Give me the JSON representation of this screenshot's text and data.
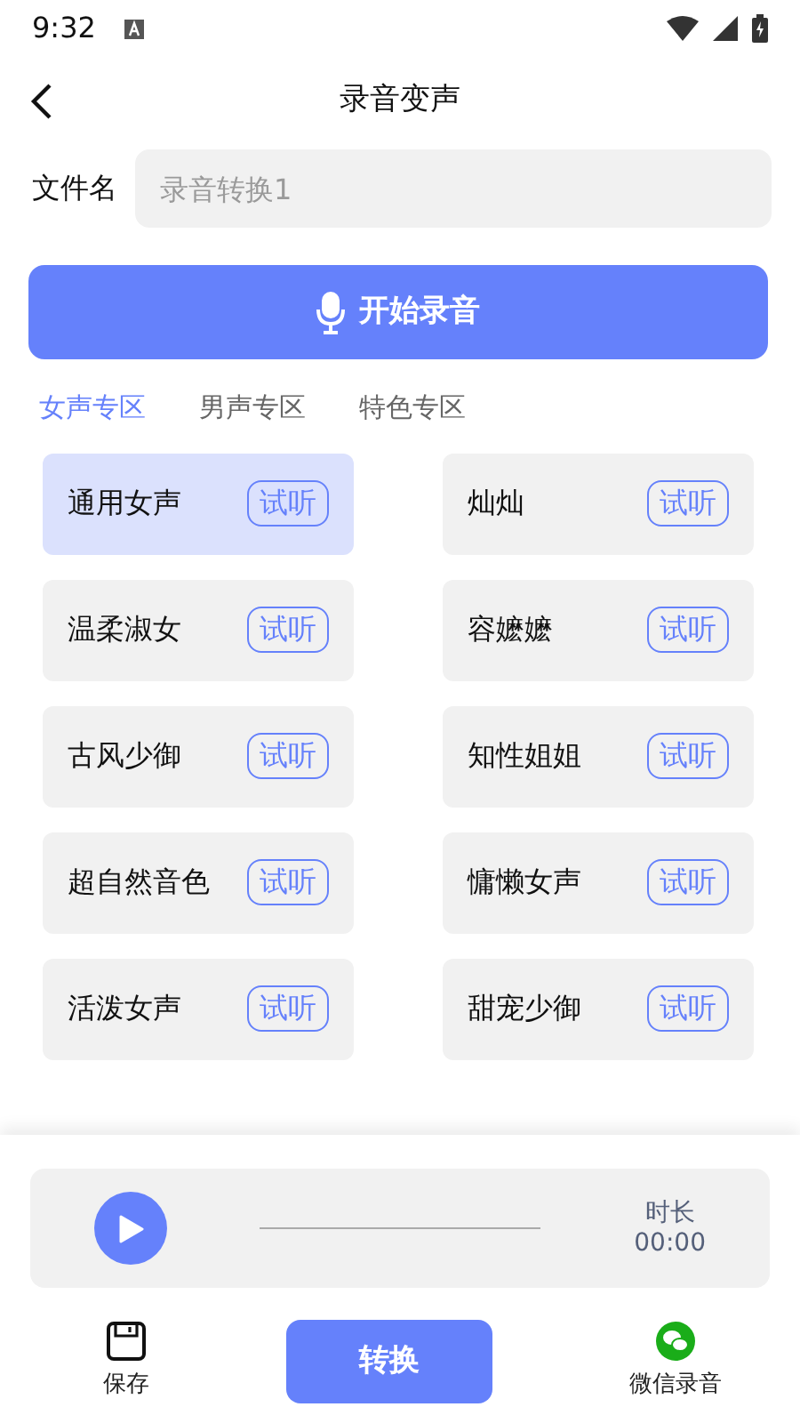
{
  "status_bar": {
    "time": "9:32"
  },
  "header": {
    "title": "录音变声"
  },
  "file_name": {
    "label": "文件名",
    "placeholder": "录音转换1"
  },
  "record_button": {
    "label": "开始录音"
  },
  "tabs": [
    {
      "label": "女声专区",
      "selected": true
    },
    {
      "label": "男声专区",
      "selected": false
    },
    {
      "label": "特色专区",
      "selected": false
    }
  ],
  "voices": [
    {
      "name": "通用女声",
      "action": "试听",
      "selected": true
    },
    {
      "name": "灿灿",
      "action": "试听",
      "selected": false
    },
    {
      "name": "温柔淑女",
      "action": "试听",
      "selected": false
    },
    {
      "name": "容嬷嬷",
      "action": "试听",
      "selected": false
    },
    {
      "name": "古风少御",
      "action": "试听",
      "selected": false
    },
    {
      "name": "知性姐姐",
      "action": "试听",
      "selected": false
    },
    {
      "name": "超自然音色",
      "action": "试听",
      "selected": false
    },
    {
      "name": "慵懒女声",
      "action": "试听",
      "selected": false
    },
    {
      "name": "活泼女声",
      "action": "试听",
      "selected": false
    },
    {
      "name": "甜宠少御",
      "action": "试听",
      "selected": false
    }
  ],
  "player": {
    "duration_label": "时长",
    "duration": "00:00"
  },
  "bottom_bar": {
    "save": "保存",
    "convert": "转换",
    "wechat": "微信录音"
  }
}
